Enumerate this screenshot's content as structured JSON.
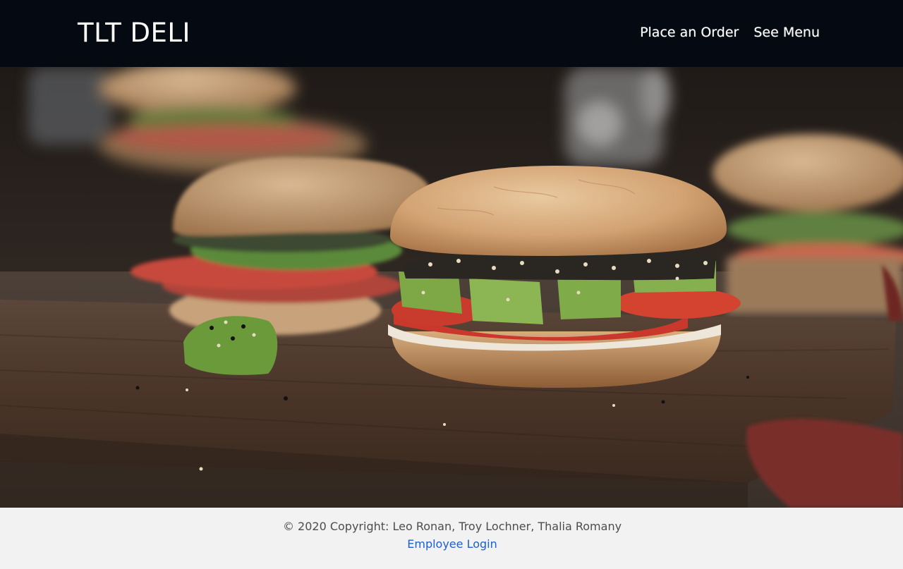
{
  "header": {
    "brand": "TLT DELI",
    "nav": [
      {
        "label": "Place an Order"
      },
      {
        "label": "See Menu"
      }
    ]
  },
  "hero": {
    "image_subject": "bagel sandwiches with avocado, tomato and cream cheese on a wooden cutting board"
  },
  "footer": {
    "copyright": "© 2020 Copyright: Leo Ronan, Troy Lochner, Thalia Romany",
    "login_label": "Employee Login"
  },
  "colors": {
    "navbar_bg": "#050a12",
    "footer_bg": "#f2f2f2",
    "link_blue": "#1a5fd6"
  }
}
